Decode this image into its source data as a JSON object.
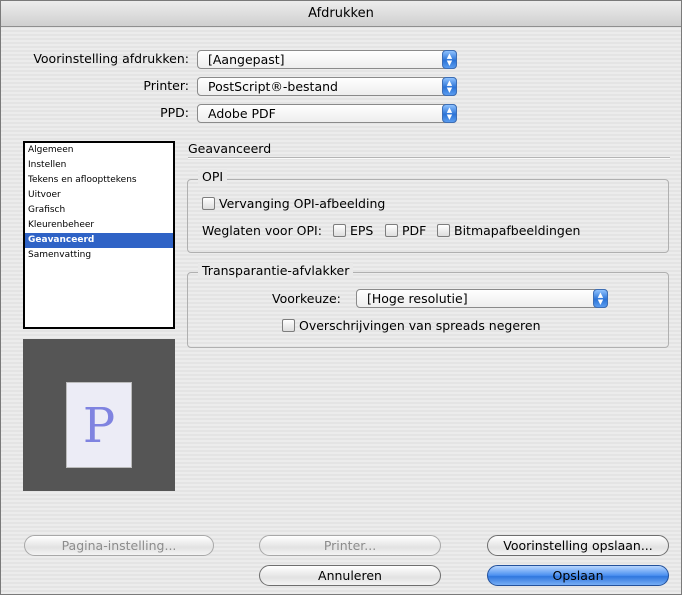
{
  "window": {
    "title": "Afdrukken"
  },
  "header": {
    "preset_label": "Voorinstelling afdrukken:",
    "preset_value": "[Aangepast]",
    "printer_label": "Printer:",
    "printer_value": "PostScript®-bestand",
    "ppd_label": "PPD:",
    "ppd_value": "Adobe PDF"
  },
  "sidebar": {
    "items": [
      {
        "label": "Algemeen",
        "selected": false
      },
      {
        "label": "Instellen",
        "selected": false
      },
      {
        "label": "Tekens en afloopttekens",
        "selected": false
      },
      {
        "label": "Uitvoer",
        "selected": false
      },
      {
        "label": "Grafisch",
        "selected": false
      },
      {
        "label": "Kleurenbeheer",
        "selected": false
      },
      {
        "label": "Geavanceerd",
        "selected": true
      },
      {
        "label": "Samenvatting",
        "selected": false
      }
    ]
  },
  "preview": {
    "letter": "P"
  },
  "main": {
    "section_title": "Geavanceerd",
    "opi": {
      "title": "OPI",
      "replace_label": "Vervanging OPI-afbeelding",
      "omit_label": "Weglaten voor OPI:",
      "eps_label": "EPS",
      "pdf_label": "PDF",
      "bitmap_label": "Bitmapafbeeldingen"
    },
    "transparency": {
      "title": "Transparantie-afvlakker",
      "preset_label": "Voorkeuze:",
      "preset_value": "[Hoge resolutie]",
      "ignore_label": "Overschrijvingen van spreads negeren"
    }
  },
  "footer": {
    "page_setup": "Pagina-instelling...",
    "printer": "Printer...",
    "save_preset": "Voorinstelling opslaan...",
    "cancel": "Annuleren",
    "save": "Opslaan"
  }
}
